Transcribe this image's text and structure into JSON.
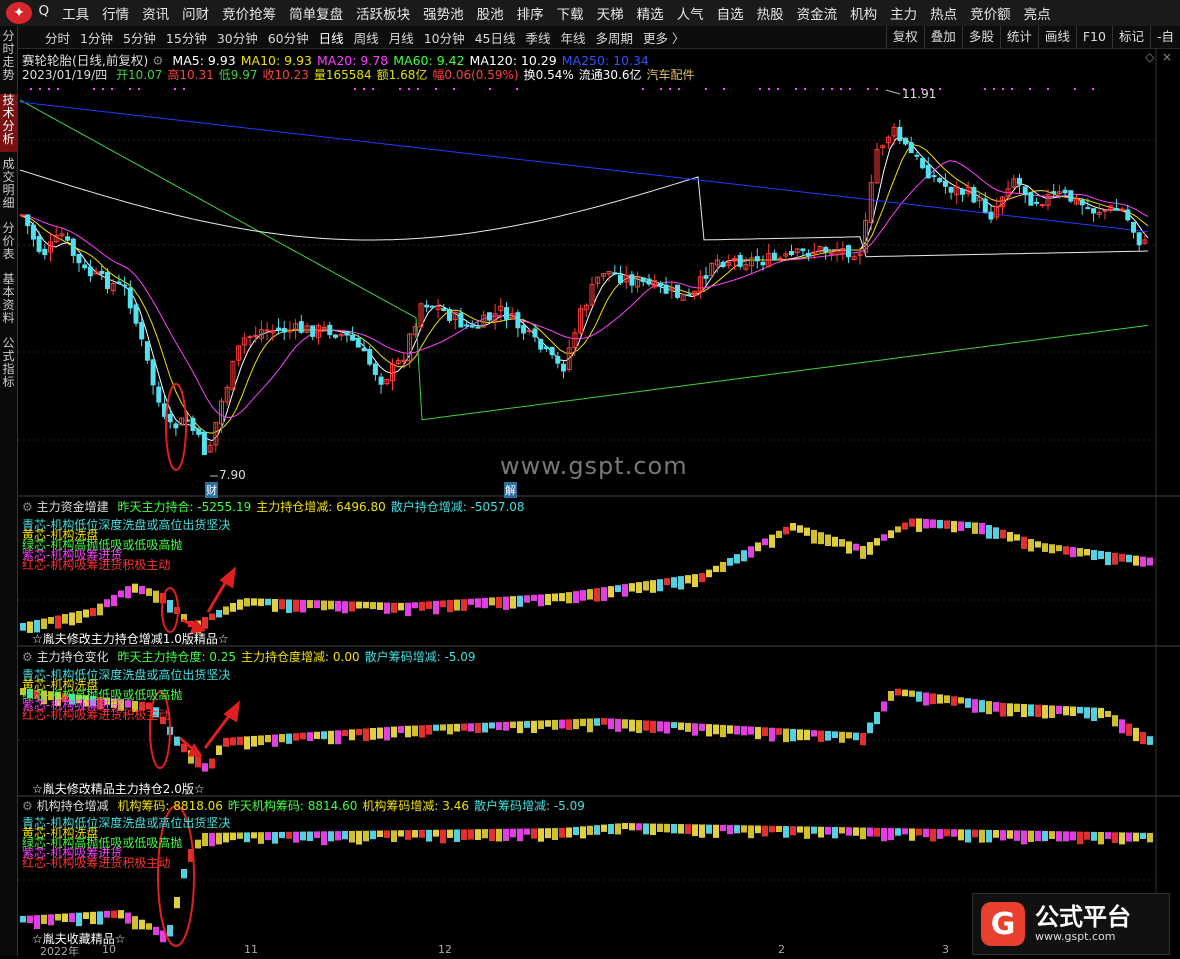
{
  "menu": [
    "Q",
    "工具",
    "行情",
    "资讯",
    "问财",
    "竞价抢筹",
    "简单复盘",
    "活跃板块",
    "强势池",
    "股池",
    "排序",
    "下载",
    "天梯",
    "精选",
    "人气",
    "自选",
    "热股",
    "资金流",
    "机构",
    "主力",
    "热点",
    "竞价额",
    "亮点"
  ],
  "periods": [
    "分时",
    "1分钟",
    "5分钟",
    "15分钟",
    "30分钟",
    "60分钟",
    "日线",
    "周线",
    "月线",
    "10分钟",
    "45日线",
    "季线",
    "年线",
    "多周期",
    "更多 〉"
  ],
  "active_period": "日线",
  "right_buttons": [
    "复权",
    "叠加",
    "多股",
    "统计",
    "画线",
    "F10",
    "标记",
    "-自"
  ],
  "side_tabs": [
    "分时走势",
    "技术分析",
    "成交明细",
    "分价表",
    "基本资料",
    "公式指标"
  ],
  "active_side": "技术分析",
  "stock": {
    "name": "赛轮轮胎(日线,前复权)",
    "date": "2023/01/19/四"
  },
  "ma": [
    {
      "label": "MA5: 9.93",
      "color": "#ffffff"
    },
    {
      "label": "MA10: 9.93",
      "color": "#f0e000"
    },
    {
      "label": "MA20: 9.78",
      "color": "#ff40ff"
    },
    {
      "label": "MA60: 9.42",
      "color": "#40ff40"
    },
    {
      "label": "MA120: 10.29",
      "color": "#ffffff"
    },
    {
      "label": "MA250: 10.34",
      "color": "#3050ff"
    }
  ],
  "quote": [
    {
      "label": "开10.07",
      "color": "#40d040"
    },
    {
      "label": "高10.31",
      "color": "#ff4040"
    },
    {
      "label": "低9.97",
      "color": "#40d040"
    },
    {
      "label": "收10.23",
      "color": "#ff4040"
    },
    {
      "label": "量165584",
      "color": "#e0e000"
    },
    {
      "label": "额1.68亿",
      "color": "#e0e000"
    },
    {
      "label": "幅0.06(0.59%)",
      "color": "#ff4040"
    },
    {
      "label": "换0.54%",
      "color": "#ffffff"
    },
    {
      "label": "流通30.6亿",
      "color": "#ffffff"
    },
    {
      "label": "汽车配件",
      "color": "#e0c060"
    }
  ],
  "price_labels": {
    "high": "11.91",
    "low": "7.90",
    "event1": "财",
    "event2": "解"
  },
  "watermark": "www.gspt.com",
  "sub1": {
    "title": "主力资金增建",
    "items": [
      {
        "label": "昨天主力持合: -5255.19",
        "color": "#40ff40"
      },
      {
        "label": "主力持仓增减: 6496.80",
        "color": "#f0e000"
      },
      {
        "label": "散户持仓增减: -5057.08",
        "color": "#40e0e0"
      }
    ],
    "footer": "☆胤夫修改主力持仓增减1.0版精品☆"
  },
  "sub2": {
    "title": "主力持仓变化",
    "items": [
      {
        "label": "昨天主力持仓度: 0.25",
        "color": "#40ff40"
      },
      {
        "label": "主力持仓度增减: 0.00",
        "color": "#f0e000"
      },
      {
        "label": "散户筹码增减: -5.09",
        "color": "#40e0e0"
      }
    ],
    "footer": "☆胤夫修改精品主力持仓2.0版☆"
  },
  "sub3": {
    "title": "机构持仓增减",
    "items": [
      {
        "label": "机构筹码: 8818.06",
        "color": "#f0e000"
      },
      {
        "label": "昨天机构筹码: 8814.60",
        "color": "#40ff40"
      },
      {
        "label": "机构筹码增减: 3.46",
        "color": "#f0e000"
      },
      {
        "label": "散户筹码增减: -5.09",
        "color": "#40e0e0"
      }
    ],
    "footer": "☆胤夫收藏精品☆"
  },
  "legend_lines": [
    {
      "label": "青芯-机构低位深度洗盘或高位出货坚决",
      "color": "#40e0e0"
    },
    {
      "label": "黄芯-机构洗盘",
      "color": "#f0e000"
    },
    {
      "label": "绿芯-机构高抛低吸或低吸高抛",
      "color": "#40ff40"
    },
    {
      "label": "紫芯-机构吸筹进货",
      "color": "#ff40ff"
    },
    {
      "label": "红芯-机构吸筹进货积极主动",
      "color": "#ff3030"
    }
  ],
  "axis_dates": [
    "2022年",
    "10",
    "11",
    "12",
    "2",
    "3"
  ],
  "badge": {
    "name": "公式平台",
    "url": "www.gspt.com"
  }
}
